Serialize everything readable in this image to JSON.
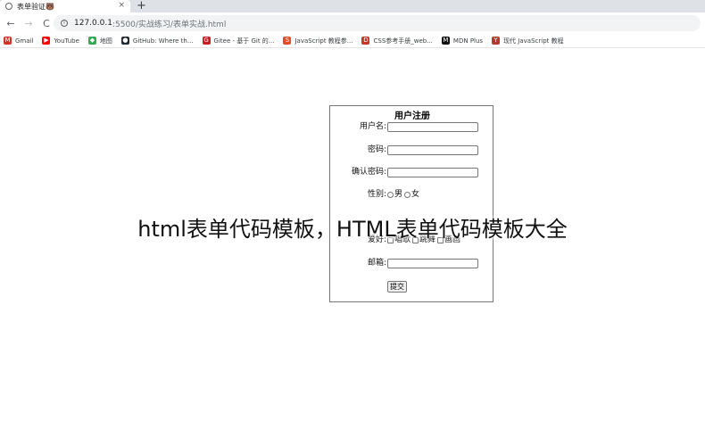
{
  "browser": {
    "tab_title": "表单验证🐻",
    "close_glyph": "×",
    "new_tab_glyph": "+",
    "back_glyph": "←",
    "forward_glyph": "→",
    "reload_glyph": "C",
    "url_host": "127.0.0.1",
    "url_path": ":5500/实战练习/表单实战.html",
    "bookmarks": [
      {
        "label": "Gmail",
        "icon": "gmail-icon",
        "color": "#d93025",
        "glyph": "M"
      },
      {
        "label": "YouTube",
        "icon": "youtube-icon",
        "color": "#ff0000",
        "glyph": "▶"
      },
      {
        "label": "地图",
        "icon": "maps-icon",
        "color": "#34a853",
        "glyph": "◆"
      },
      {
        "label": "GitHub: Where th...",
        "icon": "github-icon",
        "color": "#24292e",
        "glyph": "●"
      },
      {
        "label": "Gitee - 基于 Git 的...",
        "icon": "gitee-icon",
        "color": "#c71d23",
        "glyph": "G"
      },
      {
        "label": "JavaScript 教程参...",
        "icon": "js-tutorial-icon",
        "color": "#e34c26",
        "glyph": "S"
      },
      {
        "label": "CSS参考手册_web...",
        "icon": "css-reference-icon",
        "color": "#c0392b",
        "glyph": "D"
      },
      {
        "label": "MDN Plus",
        "icon": "mdn-icon",
        "color": "#111111",
        "glyph": "M"
      },
      {
        "label": "现代 JavaScript 教程",
        "icon": "modern-js-icon",
        "color": "#b03a2e",
        "glyph": "Y"
      }
    ]
  },
  "form": {
    "title": "用户注册",
    "username_label": "用户名:",
    "password_label": "密码:",
    "confirm_label": "确认密码:",
    "gender_label": "性别:",
    "gender_options": [
      "男",
      "女"
    ],
    "hobby_label": "爱好:",
    "hobby_options": [
      "唱歌",
      "跳舞",
      "画画"
    ],
    "email_label": "邮箱:",
    "submit_label": "提交"
  },
  "overlay": {
    "caption": "html表单代码模板，HTML表单代码模板大全"
  }
}
